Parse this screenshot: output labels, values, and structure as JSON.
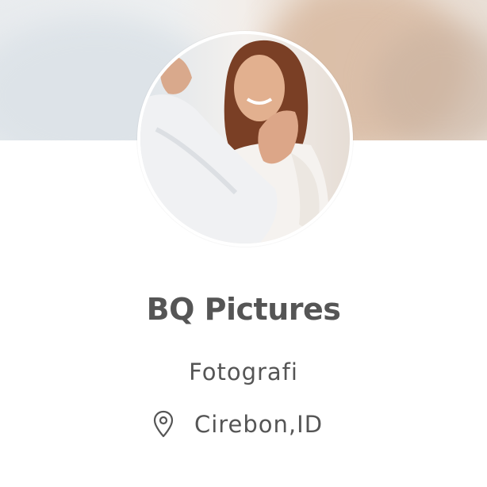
{
  "profile": {
    "name": "BQ Pictures",
    "category": "Fotografi",
    "location": "Cirebon,ID",
    "location_icon": "map-pin-icon"
  },
  "colors": {
    "text": "#555555",
    "background": "#ffffff"
  }
}
